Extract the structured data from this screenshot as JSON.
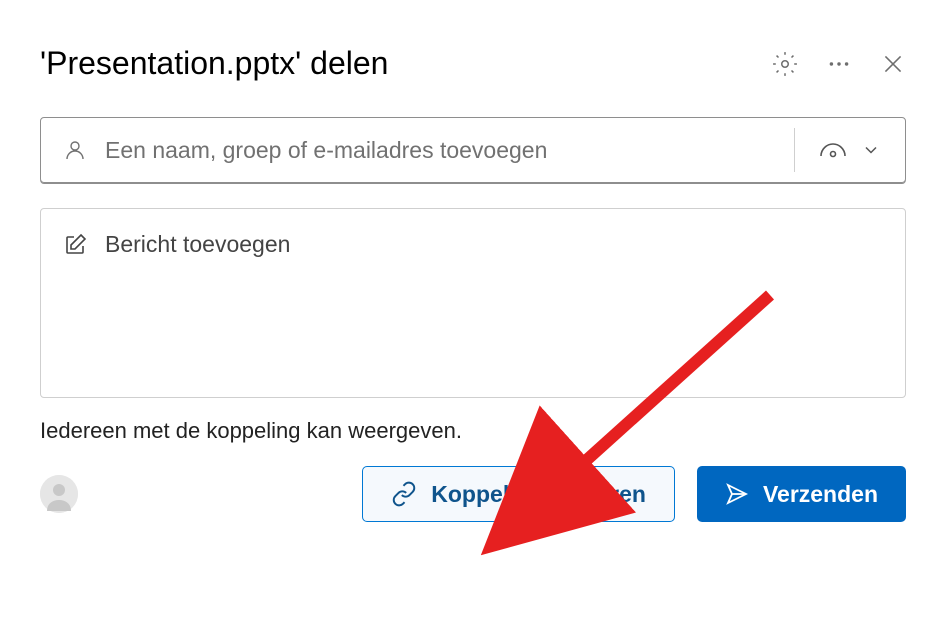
{
  "header": {
    "title": "'Presentation.pptx' delen"
  },
  "recipient": {
    "placeholder": "Een naam, groep of e-mailadres toevoegen"
  },
  "message": {
    "placeholder": "Bericht toevoegen"
  },
  "info": {
    "text": "Iedereen met de koppeling kan weergeven."
  },
  "actions": {
    "copy_label": "Koppeling kopiëren",
    "send_label": "Verzenden"
  }
}
